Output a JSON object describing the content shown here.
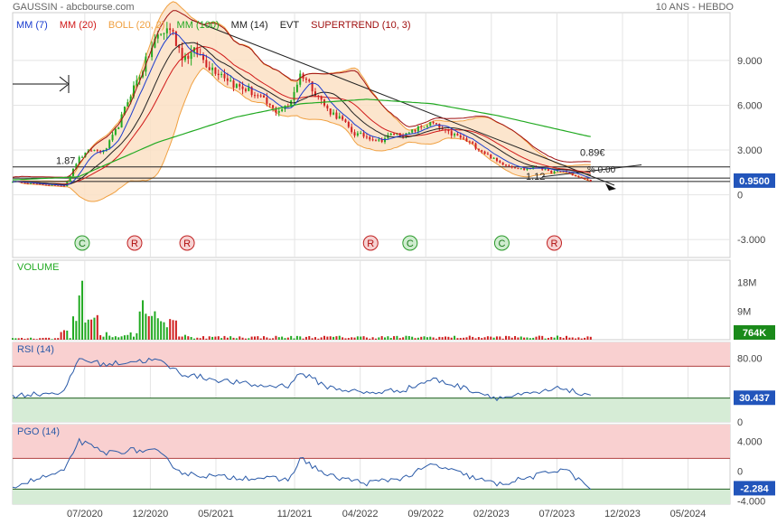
{
  "header": {
    "symbol": "GAUSSIN - abcbourse.com",
    "period": "10 ANS - HEBDO"
  },
  "colors": {
    "mm7": "#1a3ccf",
    "mm20": "#d01818",
    "boll": "#f0a040",
    "bollFill": "#fbe0c4",
    "mm100": "#22aa22",
    "mm14": "#222222",
    "supertrend": "#a01010",
    "up": "#22aa22",
    "down": "#d02020",
    "rsi": "#2a5aa8",
    "pgo": "#2a5aa8",
    "overbought": "#f9d0d0",
    "oversold": "#d6ecd6",
    "grid": "#e4e4e4",
    "lastValueBg": "#2255bb",
    "volumeBg": "#1a8a1a"
  },
  "legend": [
    {
      "label": "MM (7)",
      "color": "#1a3ccf"
    },
    {
      "label": "MM (20)",
      "color": "#d01818"
    },
    {
      "label": "BOLL (20, 2)",
      "color": "#f0a040"
    },
    {
      "label": "MM (100)",
      "color": "#22aa22"
    },
    {
      "label": "MM (14)",
      "color": "#222222"
    },
    {
      "label": "EVT",
      "color": "#222222"
    },
    {
      "label": "SUPERTREND (10, 3)",
      "color": "#a01010"
    }
  ],
  "chart_data": [
    {
      "type": "candlestick",
      "title": "",
      "x_ticks": [
        "07/2020",
        "12/2020",
        "05/2021",
        "11/2021",
        "04/2022",
        "09/2022",
        "02/2023",
        "07/2023",
        "12/2023",
        "05/2024"
      ],
      "y_ticks": [
        9.0,
        6.0,
        3.0,
        0,
        -3.0
      ],
      "y_tick_labels": [
        "9.000",
        "6.000",
        "3.000",
        "0",
        "-3.000"
      ],
      "ylim": [
        -4.2,
        12.2
      ],
      "last_value_label": "0.9500",
      "levels": [
        {
          "label": "1.87",
          "value": 1.87
        },
        {
          "label": "1.12",
          "value": 1.12
        },
        {
          "label": "0.89€",
          "value": 0.89
        }
      ],
      "pct_label": "% 0.00",
      "events": [
        {
          "label": "C",
          "kind": "C",
          "date": "2020-06"
        },
        {
          "label": "R",
          "kind": "R",
          "date": "2020-10"
        },
        {
          "label": "R",
          "kind": "R",
          "date": "2021-02"
        },
        {
          "label": "R",
          "kind": "R",
          "date": "2022-04"
        },
        {
          "label": "C",
          "kind": "C",
          "date": "2022-07"
        },
        {
          "label": "C",
          "kind": "C",
          "date": "2023-02"
        },
        {
          "label": "R",
          "kind": "R",
          "date": "2023-06"
        }
      ],
      "series": {
        "close_keypoints": [
          [
            "2020-01",
            0.9
          ],
          [
            "2020-03",
            0.7
          ],
          [
            "2020-05",
            0.6
          ],
          [
            "2020-06",
            2.4
          ],
          [
            "2020-07",
            3.0
          ],
          [
            "2020-08",
            2.9
          ],
          [
            "2020-09",
            4.5
          ],
          [
            "2020-10",
            6.8
          ],
          [
            "2020-11",
            8.6
          ],
          [
            "2020-12",
            10.6
          ],
          [
            "2021-01",
            11.2
          ],
          [
            "2021-02",
            9.2
          ],
          [
            "2021-03",
            9.6
          ],
          [
            "2021-04",
            8.6
          ],
          [
            "2021-05",
            8.1
          ],
          [
            "2021-06",
            7.3
          ],
          [
            "2021-07",
            7.0
          ],
          [
            "2021-08",
            6.4
          ],
          [
            "2021-09",
            5.6
          ],
          [
            "2021-10",
            5.9
          ],
          [
            "2021-11",
            8.2
          ],
          [
            "2021-12",
            7.0
          ],
          [
            "2022-01",
            5.7
          ],
          [
            "2022-02",
            5.1
          ],
          [
            "2022-03",
            4.1
          ],
          [
            "2022-04",
            3.9
          ],
          [
            "2022-05",
            3.6
          ],
          [
            "2022-06",
            4.1
          ],
          [
            "2022-07",
            4.0
          ],
          [
            "2022-08",
            4.5
          ],
          [
            "2022-09",
            4.8
          ],
          [
            "2022-10",
            4.2
          ],
          [
            "2022-11",
            3.9
          ],
          [
            "2022-12",
            3.4
          ],
          [
            "2023-01",
            2.8
          ],
          [
            "2023-02",
            2.2
          ],
          [
            "2023-03",
            1.9
          ],
          [
            "2023-04",
            1.7
          ],
          [
            "2023-05",
            1.9
          ],
          [
            "2023-06",
            1.5
          ],
          [
            "2023-07",
            1.6
          ],
          [
            "2023-08",
            1.2
          ],
          [
            "2023-09",
            0.95
          ]
        ],
        "mm100_keypoints": [
          [
            "2020-01",
            1.0
          ],
          [
            "2020-06",
            1.2
          ],
          [
            "2020-12",
            3.5
          ],
          [
            "2021-06",
            5.2
          ],
          [
            "2021-11",
            6.1
          ],
          [
            "2022-04",
            6.4
          ],
          [
            "2022-09",
            6.1
          ],
          [
            "2023-02",
            5.3
          ],
          [
            "2023-09",
            3.9
          ]
        ]
      }
    },
    {
      "type": "bar",
      "title": "VOLUME",
      "y_ticks": [
        18,
        9
      ],
      "y_tick_labels": [
        "18M",
        "9M"
      ],
      "ylim": [
        0,
        25
      ],
      "last_value_label": "764K",
      "peaks": [
        [
          "2020-06",
          22
        ],
        [
          "2020-07",
          8
        ],
        [
          "2020-11",
          13
        ],
        [
          "2020-12",
          10
        ],
        [
          "2021-01",
          7
        ]
      ],
      "baseline": 0.8
    },
    {
      "type": "line",
      "title": "RSI (14)",
      "y_ticks": [
        80,
        30,
        0
      ],
      "y_tick_labels": [
        "80.00",
        "30.00",
        "0"
      ],
      "ylim": [
        0,
        100
      ],
      "overbought": 70,
      "oversold": 30,
      "last_value_label": "30.437",
      "keypoints": [
        [
          "2020-01",
          33
        ],
        [
          "2020-05",
          38
        ],
        [
          "2020-06",
          80
        ],
        [
          "2020-08",
          72
        ],
        [
          "2020-10",
          76
        ],
        [
          "2020-12",
          78
        ],
        [
          "2021-02",
          60
        ],
        [
          "2021-05",
          52
        ],
        [
          "2021-08",
          45
        ],
        [
          "2021-10",
          46
        ],
        [
          "2021-11",
          62
        ],
        [
          "2022-01",
          44
        ],
        [
          "2022-04",
          36
        ],
        [
          "2022-07",
          41
        ],
        [
          "2022-09",
          54
        ],
        [
          "2022-12",
          40
        ],
        [
          "2023-02",
          30
        ],
        [
          "2023-05",
          36
        ],
        [
          "2023-07",
          43
        ],
        [
          "2023-09",
          30.4
        ]
      ]
    },
    {
      "type": "line",
      "title": "PGO (14)",
      "y_ticks": [
        4.0,
        0,
        -4.0
      ],
      "y_tick_labels": [
        "4.000",
        "0",
        "-4.000"
      ],
      "ylim": [
        -4.4,
        6.2
      ],
      "overbought": 1.7,
      "oversold": -2.4,
      "last_value_label": "-2.284",
      "keypoints": [
        [
          "2020-01",
          -2.0
        ],
        [
          "2020-05",
          0.0
        ],
        [
          "2020-06",
          4.1
        ],
        [
          "2020-08",
          2.4
        ],
        [
          "2020-10",
          2.8
        ],
        [
          "2020-12",
          2.6
        ],
        [
          "2021-02",
          -0.3
        ],
        [
          "2021-05",
          -0.8
        ],
        [
          "2021-08",
          -0.9
        ],
        [
          "2021-10",
          -1.2
        ],
        [
          "2021-11",
          1.7
        ],
        [
          "2022-01",
          -0.6
        ],
        [
          "2022-04",
          -1.6
        ],
        [
          "2022-07",
          -0.8
        ],
        [
          "2022-09",
          0.9
        ],
        [
          "2022-12",
          -0.8
        ],
        [
          "2023-02",
          -1.8
        ],
        [
          "2023-05",
          -0.6
        ],
        [
          "2023-07",
          0.4
        ],
        [
          "2023-09",
          -2.28
        ]
      ]
    }
  ]
}
